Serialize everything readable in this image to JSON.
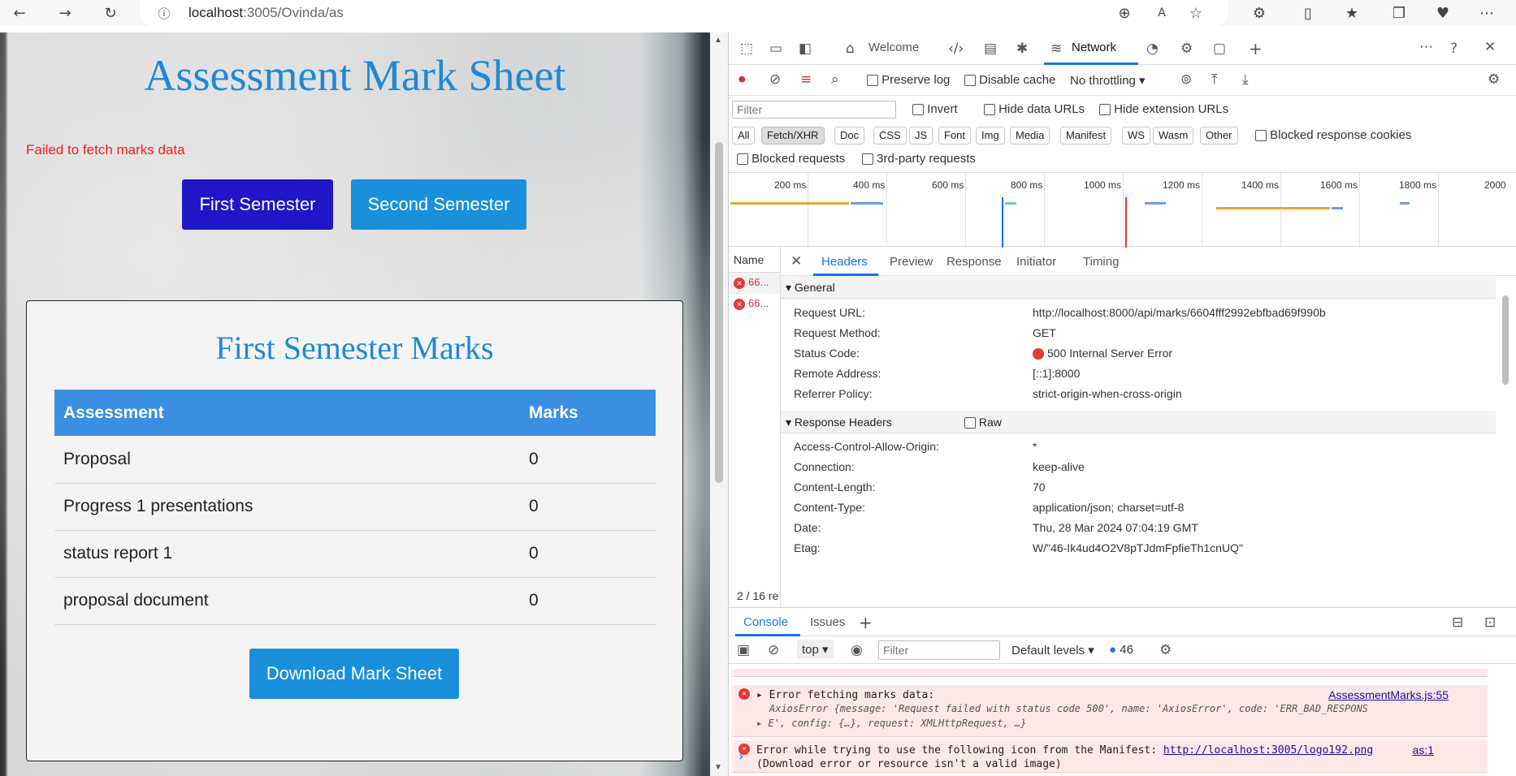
{
  "browser": {
    "url_host": "localhost",
    "url_path": ":3005/Ovinda/as"
  },
  "page": {
    "title": "Assessment Mark Sheet",
    "error": "Failed to fetch marks data",
    "buttons": {
      "first": "First Semester",
      "second": "Second Semester",
      "download": "Download Mark Sheet"
    },
    "card_title": "First Semester Marks",
    "table": {
      "headers": [
        "Assessment",
        "Marks"
      ],
      "rows": [
        [
          "Proposal",
          "0"
        ],
        [
          "Progress 1 presentations",
          "0"
        ],
        [
          "status report 1",
          "0"
        ],
        [
          "proposal document",
          "0"
        ]
      ]
    }
  },
  "devtools": {
    "tabs": {
      "welcome": "Welcome",
      "network": "Network"
    },
    "toolbar": {
      "preserve_log": "Preserve log",
      "disable_cache": "Disable cache",
      "throttling": "No throttling"
    },
    "filter": {
      "placeholder": "Filter",
      "invert": "Invert",
      "hide_data": "Hide data URLs",
      "hide_ext": "Hide extension URLs"
    },
    "chips": [
      "All",
      "Fetch/XHR",
      "Doc",
      "CSS",
      "JS",
      "Font",
      "Img",
      "Media",
      "Manifest",
      "WS",
      "Wasm",
      "Other"
    ],
    "blocked_cookies": "Blocked response cookies",
    "blocked_requests": "Blocked requests",
    "third_party": "3rd-party requests",
    "timeline_ticks": [
      "200 ms",
      "400 ms",
      "600 ms",
      "800 ms",
      "1000 ms",
      "1200 ms",
      "1400 ms",
      "1600 ms",
      "1800 ms",
      "2000"
    ],
    "name_header": "Name",
    "requests": [
      "66...",
      "66..."
    ],
    "request_count": "2 / 16 re",
    "detail_tabs": [
      "Headers",
      "Preview",
      "Response",
      "Initiator",
      "Timing"
    ],
    "general_title": "General",
    "general": [
      [
        "Request URL:",
        "http://localhost:8000/api/marks/6604fff2992ebfbad69f990b"
      ],
      [
        "Request Method:",
        "GET"
      ],
      [
        "Status Code:",
        "500 Internal Server Error"
      ],
      [
        "Remote Address:",
        "[::1]:8000"
      ],
      [
        "Referrer Policy:",
        "strict-origin-when-cross-origin"
      ]
    ],
    "response_title": "Response Headers",
    "raw_label": "Raw",
    "response": [
      [
        "Access-Control-Allow-Origin:",
        "*"
      ],
      [
        "Connection:",
        "keep-alive"
      ],
      [
        "Content-Length:",
        "70"
      ],
      [
        "Content-Type:",
        "application/json; charset=utf-8"
      ],
      [
        "Date:",
        "Thu, 28 Mar 2024 07:04:19 GMT"
      ],
      [
        "Etag:",
        "W/\"46-Ik4ud4O2V8pTJdmFpfieTh1cnUQ\""
      ]
    ],
    "console": {
      "tabs": [
        "Console",
        "Issues"
      ],
      "context": "top",
      "filter_placeholder": "Filter",
      "levels": "Default levels",
      "count": "46",
      "msg1_title": "Error fetching marks data:",
      "msg1_link": "AssessmentMarks.js:55",
      "msg1_detail_a": "AxiosError {message: 'Request failed with status code 500', name: 'AxiosError', code: 'ERR_BAD_RESPONS",
      "msg1_detail_b": "E', config: {…}, request: XMLHttpRequest, …}",
      "msg2_a": "Error while trying to use the following icon from the Manifest:",
      "msg2_url": "http://localhost:3005/logo192.png",
      "msg2_link": "as:1",
      "msg2_b": "(Download error or resource isn't a valid image)"
    }
  }
}
